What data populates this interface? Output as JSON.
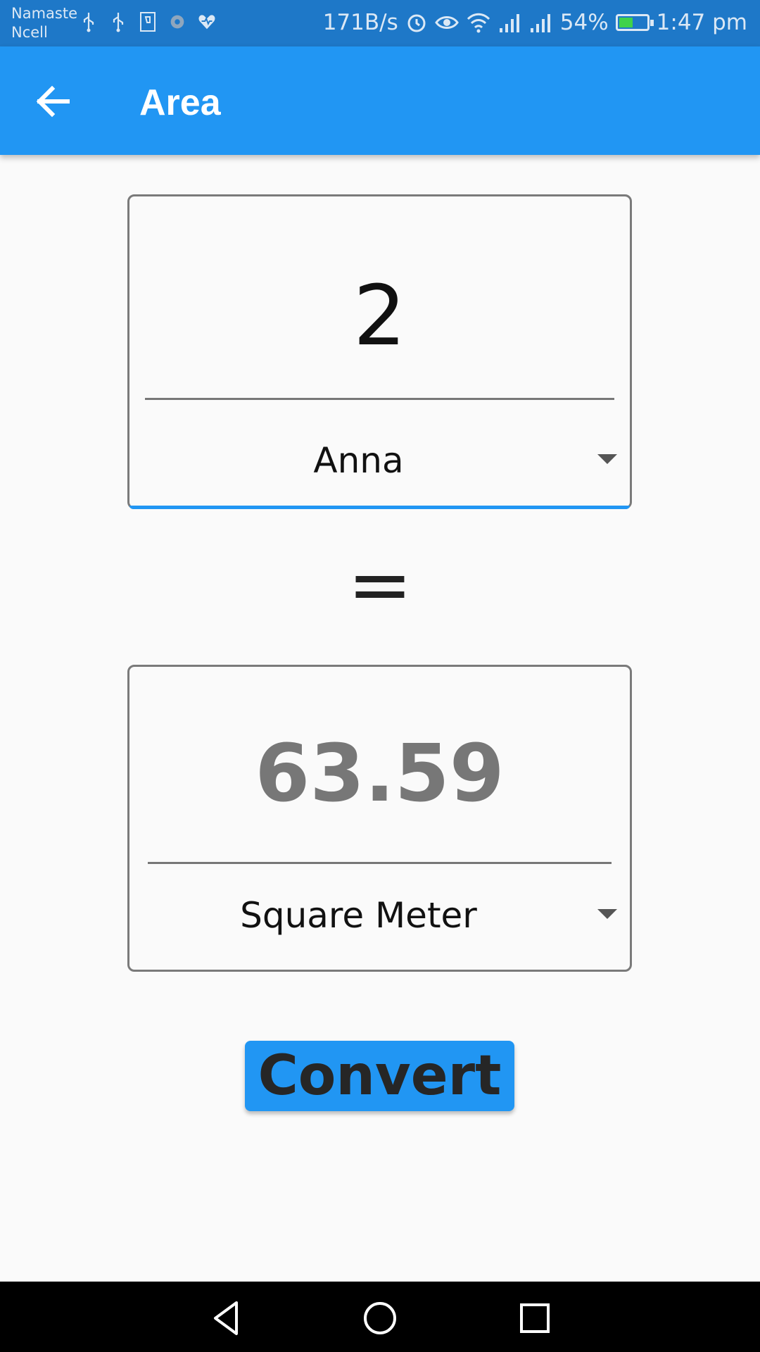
{
  "status_bar": {
    "carrier_line1": "Namaste",
    "carrier_line2": "Ncell",
    "left_icons": [
      "usb-icon",
      "usb-icon",
      "sim-icon",
      "settings-icon",
      "health-icon"
    ],
    "net_speed": "171B/s",
    "battery_percent": "54%",
    "battery_level": 0.54,
    "time": "1:47 pm"
  },
  "app_bar": {
    "title": "Area",
    "back_icon": "arrow-left-icon"
  },
  "input_card": {
    "value": "2",
    "unit": "Anna"
  },
  "equals_sign": "=",
  "output_card": {
    "value": "63.59",
    "unit": "Square Meter"
  },
  "convert_button": {
    "label": "Convert"
  },
  "colors": {
    "primary": "#2196f3",
    "status_bar": "#1e78c8",
    "background": "#fafafa",
    "nav_bar": "#000000"
  },
  "nav_bar": {
    "icons": [
      "back-triangle-icon",
      "home-circle-icon",
      "recents-square-icon"
    ]
  }
}
